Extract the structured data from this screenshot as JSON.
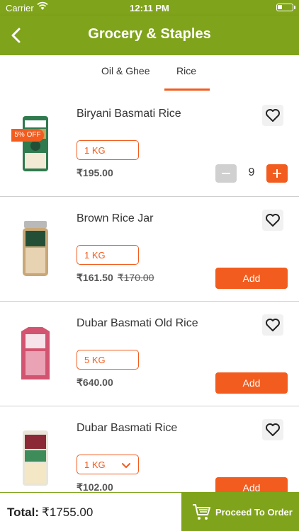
{
  "status_bar": {
    "carrier": "Carrier",
    "time": "12:11 PM"
  },
  "header": {
    "title": "Grocery & Staples"
  },
  "tabs": [
    {
      "label": "Oil & Ghee",
      "active": false
    },
    {
      "label": "Rice",
      "active": true
    }
  ],
  "products": [
    {
      "name": "Biryani Basmati Rice",
      "unit": "1 KG",
      "price": "₹195.00",
      "quantity": "9",
      "image": "daawat-biryani-pack"
    },
    {
      "name": "Brown Rice Jar",
      "unit": "1 KG",
      "price": "₹161.50",
      "mrp": "₹170.00",
      "badge": "5% OFF",
      "add_label": "Add",
      "image": "daawat-brown-rice-jar"
    },
    {
      "name": "Dubar Basmati Old Rice",
      "unit": "5 KG",
      "price": "₹640.00",
      "add_label": "Add",
      "image": "dubar-bag"
    },
    {
      "name": "Dubar Basmati Rice",
      "unit": "1 KG",
      "price": "₹102.00",
      "add_label": "Add",
      "image": "india-gate-pack"
    }
  ],
  "footer": {
    "total_label": "Total:",
    "total_value": "₹1755.00",
    "proceed_label": "Proceed To Order"
  },
  "colors": {
    "brand_green": "#7fa31a",
    "accent_orange": "#f25c1e"
  },
  "icons": [
    "wifi-icon",
    "battery-icon",
    "back-arrow-icon",
    "heart-icon",
    "minus-icon",
    "plus-icon",
    "chevron-down-icon",
    "cart-icon"
  ]
}
